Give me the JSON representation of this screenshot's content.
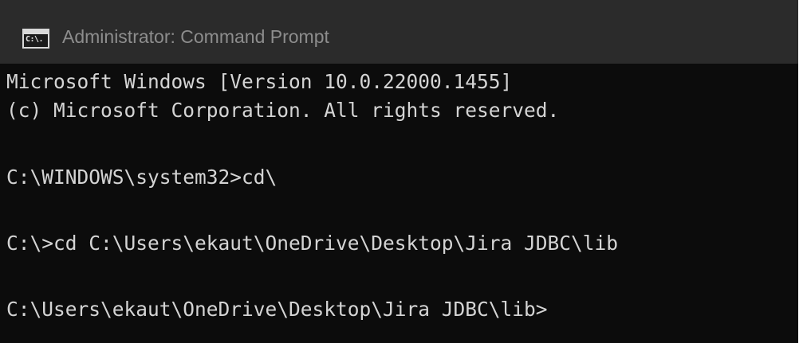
{
  "window": {
    "title": "Administrator: Command Prompt",
    "icon_name": "cmd-icon",
    "icon_glyph": "C:\\."
  },
  "console": {
    "lines": [
      "Microsoft Windows [Version 10.0.22000.1455]",
      "(c) Microsoft Corporation. All rights reserved.",
      "C:\\WINDOWS\\system32>cd\\",
      "C:\\>cd C:\\Users\\ekaut\\OneDrive\\Desktop\\Jira JDBC\\lib",
      "C:\\Users\\ekaut\\OneDrive\\Desktop\\Jira JDBC\\lib>"
    ]
  },
  "colors": {
    "titlebar_bg": "#2b2b2b",
    "title_text": "#8d8d8d",
    "console_bg": "#0c0c0c",
    "console_text": "#d4d4d4"
  }
}
